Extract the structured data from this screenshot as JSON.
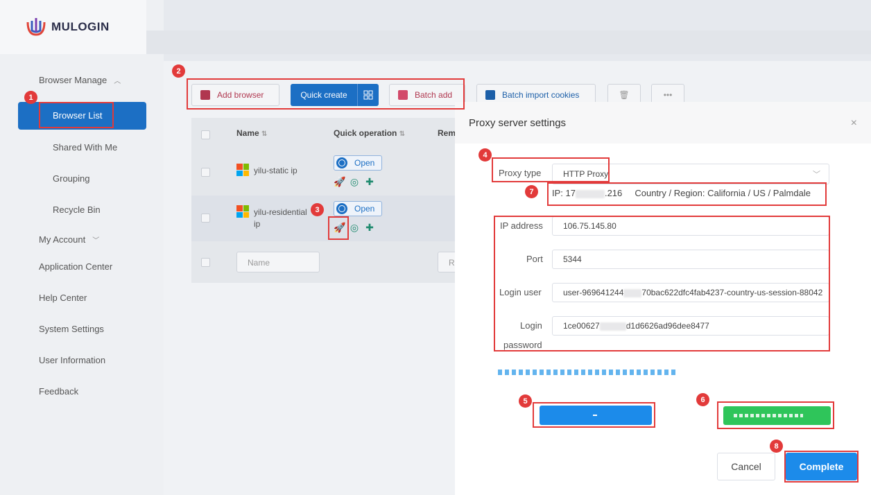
{
  "brand": {
    "name": "MULOGIN"
  },
  "sidebar": {
    "browser_manage": "Browser Manage",
    "browser_list": "Browser List",
    "shared_with_me": "Shared With Me",
    "grouping": "Grouping",
    "recycle_bin": "Recycle Bin",
    "my_account": "My Account",
    "application_center": "Application Center",
    "help_center": "Help Center",
    "system_settings": "System Settings",
    "user_information": "User Information",
    "feedback": "Feedback"
  },
  "toolbar": {
    "add_browser": "Add browser",
    "quick_create": "Quick create",
    "batch_add": "Batch add",
    "batch_import_cookies": "Batch import cookies",
    "more": "•••"
  },
  "table": {
    "headers": {
      "name": "Name",
      "quick_operation": "Quick operation",
      "remark": "Rem"
    },
    "rows": [
      {
        "name": "yilu-static ip",
        "open_label": "Open"
      },
      {
        "name": "yilu-residential ip",
        "open_label": "Open"
      }
    ],
    "name_placeholder": "Name",
    "remark_placeholder": "R"
  },
  "dialog": {
    "title": "Proxy server settings",
    "close": "×",
    "proxy_type_label": "Proxy type",
    "proxy_type_value": "HTTP Proxy",
    "ip_info_prefix": "IP: 17",
    "ip_info_suffix": ".216",
    "ip_info_region": "Country / Region: California / US / Palmdale",
    "ip_address_label": "IP address",
    "ip_address_value": "106.75.145.80",
    "port_label": "Port",
    "port_value": "5344",
    "login_user_label": "Login user",
    "login_user_value_a": "user-969641244",
    "login_user_value_b": "70bac622dfc4fab4237-country-us-session-88042",
    "login_password_label_1": "Login",
    "login_password_label_2": "password",
    "login_password_value_a": "1ce00627",
    "login_password_value_b": "d1d6626ad96dee8477",
    "cancel": "Cancel",
    "complete": "Complete"
  },
  "annotations": [
    "1",
    "2",
    "3",
    "4",
    "5",
    "6",
    "7",
    "8"
  ],
  "colors": {
    "primary": "#1c6fc4",
    "accent_blue": "#1c8bea",
    "green": "#2fc55a",
    "annotation_red": "#e23a3a"
  }
}
